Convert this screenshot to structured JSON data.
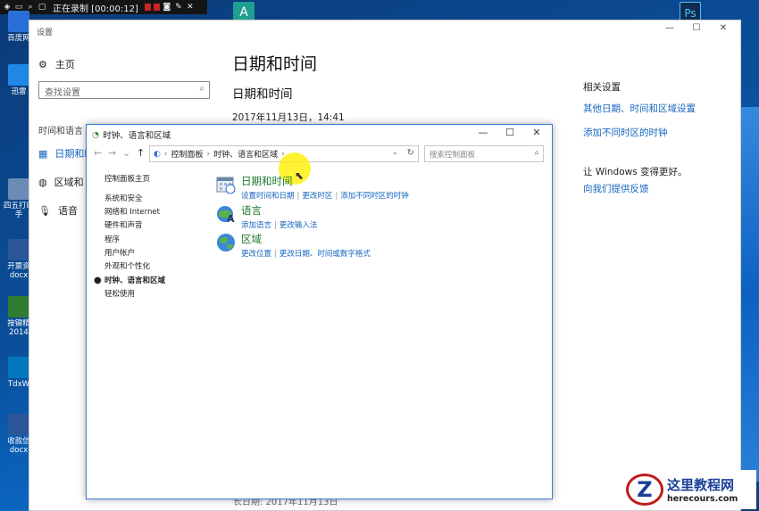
{
  "recorder": {
    "status": "正在录制 [00:00:12]"
  },
  "desktop": {
    "icons": [
      {
        "label": "百度网",
        "color": "#2a6fd6"
      },
      {
        "label": "迅雷",
        "color": "#1e88e5"
      },
      {
        "label": "四五打印手",
        "color": "#6a8bb5"
      },
      {
        "label": "开票资 docx",
        "color": "#2b579a"
      },
      {
        "label": "按键精 2014",
        "color": "#2e7d32"
      },
      {
        "label": "TdxW",
        "color": "#0277bd"
      },
      {
        "label": "收款信 docx",
        "color": "#2b579a"
      }
    ],
    "top_apps": [
      {
        "label": "A",
        "color": "#1f9f8f"
      },
      {
        "label": "Ps",
        "color": "#0d2d52"
      }
    ]
  },
  "settings": {
    "window_title": "设置",
    "home_label": "主页",
    "search_placeholder": "查找设置",
    "group_label": "时间和语言",
    "nav": [
      {
        "label": "日期和时",
        "icon": "calendar-icon"
      },
      {
        "label": "区域和",
        "icon": "globe-icon"
      },
      {
        "label": "语音",
        "icon": "microphone-icon"
      }
    ],
    "page_title": "日期和时间",
    "section_title": "日期和时间",
    "current_datetime": "2017年11月13日，14:41",
    "bottom_partial": "长日期:  2017年11月13日",
    "related": {
      "heading": "相关设置",
      "links": [
        "其他日期、时间和区域设置",
        "添加不同时区的时钟"
      ],
      "improve_text": "让 Windows 变得更好。",
      "feedback_link": "向我们提供反馈"
    }
  },
  "control_panel": {
    "window_title": "时钟、语言和区域",
    "breadcrumb": [
      "控制面板",
      "时钟、语言和区域"
    ],
    "search_placeholder": "搜索控制面板",
    "sidebar": [
      "控制面板主页",
      "系统和安全",
      "网络和 Internet",
      "硬件和声音",
      "程序",
      "用户帐户",
      "外观和个性化",
      "时钟、语言和区域",
      "轻松使用"
    ],
    "categories": [
      {
        "title": "日期和时间",
        "links": [
          "设置时间和日期",
          "更改时区",
          "添加不同时区的时钟"
        ]
      },
      {
        "title": "语言",
        "links": [
          "添加语言",
          "更改输入法"
        ]
      },
      {
        "title": "区域",
        "links": [
          "更改位置",
          "更改日期、时间或数字格式"
        ]
      }
    ]
  },
  "watermark": {
    "logo_letter": "Z",
    "name_cn": "这里教程网",
    "url": "herecours.com"
  }
}
